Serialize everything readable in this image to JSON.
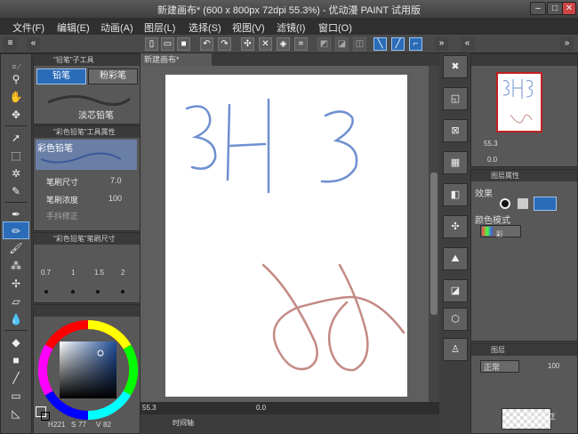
{
  "window": {
    "title": "新建画布* (600 x 800px 72dpi 55.3%) - 优动漫 PAINT 试用版",
    "min_label": "–",
    "max_label": "□",
    "close_label": "✕"
  },
  "menu": {
    "items": [
      "文件(F)",
      "编辑(E)",
      "动画(A)",
      "图层(L)",
      "选择(S)",
      "视图(V)",
      "滤镜(I)",
      "窗口(O)"
    ]
  },
  "canvas_tab": {
    "label": "新建画布*"
  },
  "subtool_panel": {
    "header": "\"铅笔\"子工具",
    "tabs": [
      "铅笔",
      "粉彩笔"
    ],
    "items": [
      "淡芯铅笔"
    ]
  },
  "tool_property": {
    "header": "\"彩色铅笔\"工具属性",
    "preview_label": "彩色铅笔",
    "rows": [
      {
        "label": "笔刷尺寸",
        "value": "7.0"
      },
      {
        "label": "笔刷浓度",
        "value": "100"
      },
      {
        "label": "手抖修正",
        "value": ""
      }
    ]
  },
  "brush_size_panel": {
    "header": "\"彩色铅笔\"笔刷尺寸",
    "values": [
      "0.7",
      "1",
      "1.5",
      "2"
    ]
  },
  "color_panel": {
    "main_color": "#1f4e9a",
    "sub_color": "#ffffff",
    "hsv_h_label": "H",
    "hsv_h_value": "221",
    "hsv_s_label": "S",
    "hsv_s_value": "77",
    "hsv_v_label": "V",
    "hsv_v_value": "82"
  },
  "navigator": {
    "zoom": "55.3",
    "angle": "0.0"
  },
  "layer_property": {
    "header": "图层属性",
    "effect_label": "效果",
    "color_mode_label": "颜色模式",
    "color_mode_value": "彩"
  },
  "layer_panel": {
    "header": "图层",
    "blend_mode": "正常",
    "opacity": "100",
    "layer_row_label": "100 % 正"
  },
  "status_bar": {
    "zoom": "55.3",
    "angle": "0.0",
    "timeline_label": "时间轴"
  },
  "drawing": {
    "stroke_blue": "#6e8fd0",
    "stroke_red": "#c48a84",
    "accent": "#2b6cb8"
  }
}
